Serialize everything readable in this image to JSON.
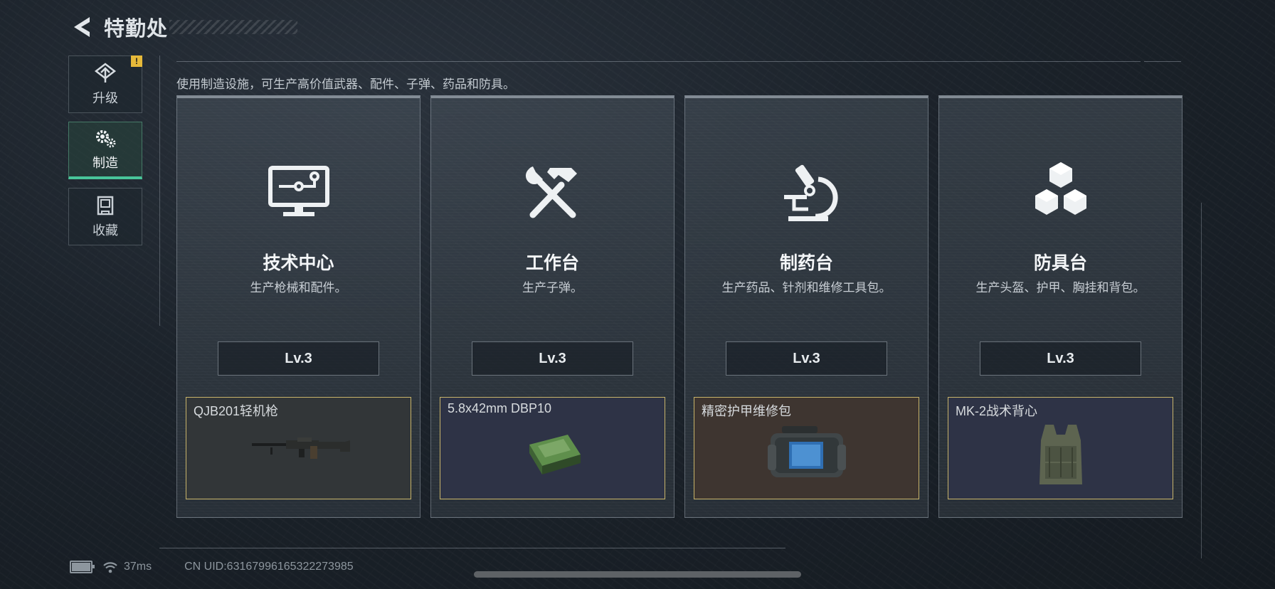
{
  "header": {
    "title": "特勤处"
  },
  "sidebar": {
    "items": [
      {
        "label": "升级",
        "icon": "upgrade-icon",
        "badge": "!",
        "active": false
      },
      {
        "label": "制造",
        "icon": "gears-icon",
        "active": true
      },
      {
        "label": "收藏",
        "icon": "collection-icon",
        "active": false
      }
    ]
  },
  "description": "使用制造设施，可生产高价值武器、配件、子弹、药品和防具。",
  "cards": [
    {
      "title": "技术中心",
      "desc": "生产枪械和配件。",
      "level": "Lv.3",
      "item_name": "QJB201轻机枪",
      "item_bg": "#323638",
      "icon": "monitor-circuit-icon"
    },
    {
      "title": "工作台",
      "desc": "生产子弹。",
      "level": "Lv.3",
      "item_name": "5.8x42mm DBP10",
      "item_bg": "#2e3346",
      "icon": "hammer-wrench-icon"
    },
    {
      "title": "制药台",
      "desc": "生产药品、针剂和维修工具包。",
      "level": "Lv.3",
      "item_name": "精密护甲维修包",
      "item_bg": "#3e3530",
      "icon": "microscope-icon"
    },
    {
      "title": "防具台",
      "desc": "生产头盔、护甲、胸挂和背包。",
      "level": "Lv.3",
      "item_name": "MK-2战术背心",
      "item_bg": "#2e3346",
      "icon": "cubes-icon"
    }
  ],
  "footer": {
    "ping": "37ms",
    "uid": "CN UID:6316799616532227398​5"
  },
  "colors": {
    "accent": "#48c59a",
    "warning": "#e6b93a",
    "item_border": "#c8b46a"
  }
}
